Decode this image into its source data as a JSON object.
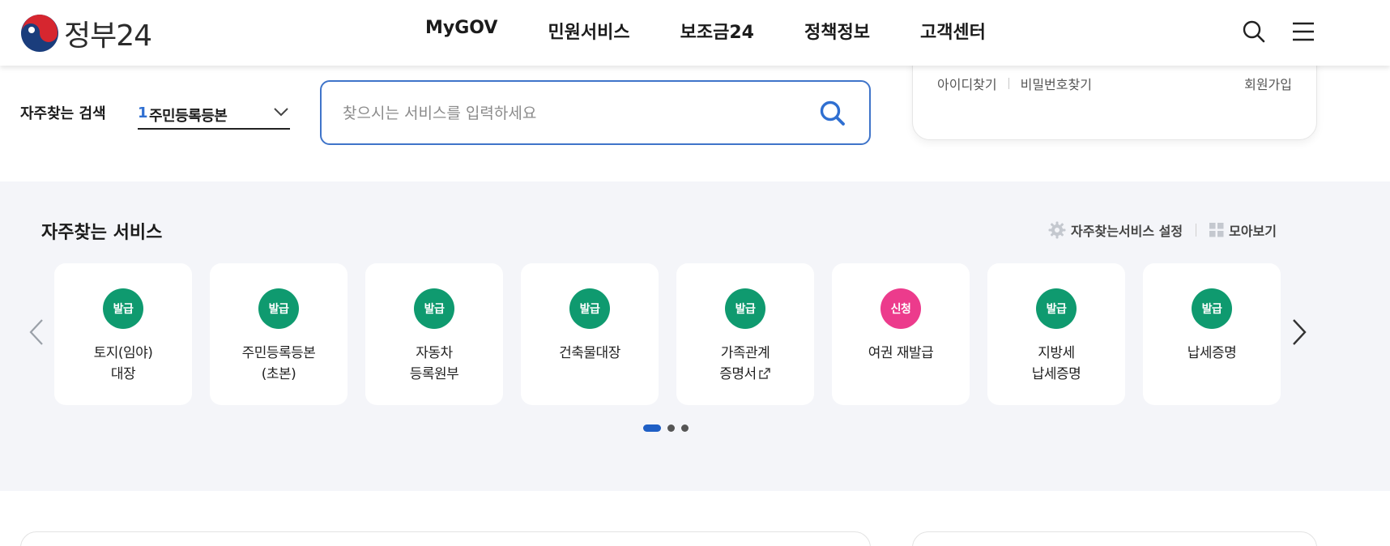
{
  "header": {
    "logo_text": "정부24",
    "nav": [
      "MyGOV",
      "민원서비스",
      "보조금24",
      "정책정보",
      "고객센터"
    ],
    "icons": [
      "search-icon",
      "menu-icon"
    ]
  },
  "search": {
    "label": "자주찾는 검색",
    "select_rank": "1",
    "select_value": "주민등록등본",
    "placeholder": "찾으시는 서비스를 입력하세요"
  },
  "login": {
    "find_id": "아이디찾기",
    "find_pw": "비밀번호찾기",
    "signup": "회원가입"
  },
  "favorites": {
    "title": "자주찾는 서비스",
    "settings_label": "자주찾는서비스 설정",
    "view_all_label": "모아보기",
    "cards": [
      {
        "badge": "발급",
        "line1": "토지(임야)",
        "line2": "대장",
        "badge_color": "#0f9a6f"
      },
      {
        "badge": "발급",
        "line1": "주민등록등본",
        "line2": "(초본)",
        "badge_color": "#0f9a6f"
      },
      {
        "badge": "발급",
        "line1": "자동차",
        "line2": "등록원부",
        "badge_color": "#0f9a6f"
      },
      {
        "badge": "발급",
        "line1": "건축물대장",
        "line2": "",
        "badge_color": "#0f9a6f"
      },
      {
        "badge": "발급",
        "line1": "가족관계",
        "line2": "증명서",
        "badge_color": "#0f9a6f",
        "external": true
      },
      {
        "badge": "신청",
        "line1": "여권 재발급",
        "line2": "",
        "badge_color": "#ec3b8c"
      },
      {
        "badge": "발급",
        "line1": "지방세",
        "line2": "납세증명",
        "badge_color": "#0f9a6f"
      },
      {
        "badge": "발급",
        "line1": "납세증명",
        "line2": "",
        "badge_color": "#0f9a6f"
      }
    ],
    "pagination": {
      "current": 1,
      "total": 3
    }
  },
  "colors": {
    "accent": "#3f74c9",
    "issue_badge": "#0f9a6f",
    "apply_badge": "#ec3b8c",
    "section_bg": "#f4f5f9"
  }
}
